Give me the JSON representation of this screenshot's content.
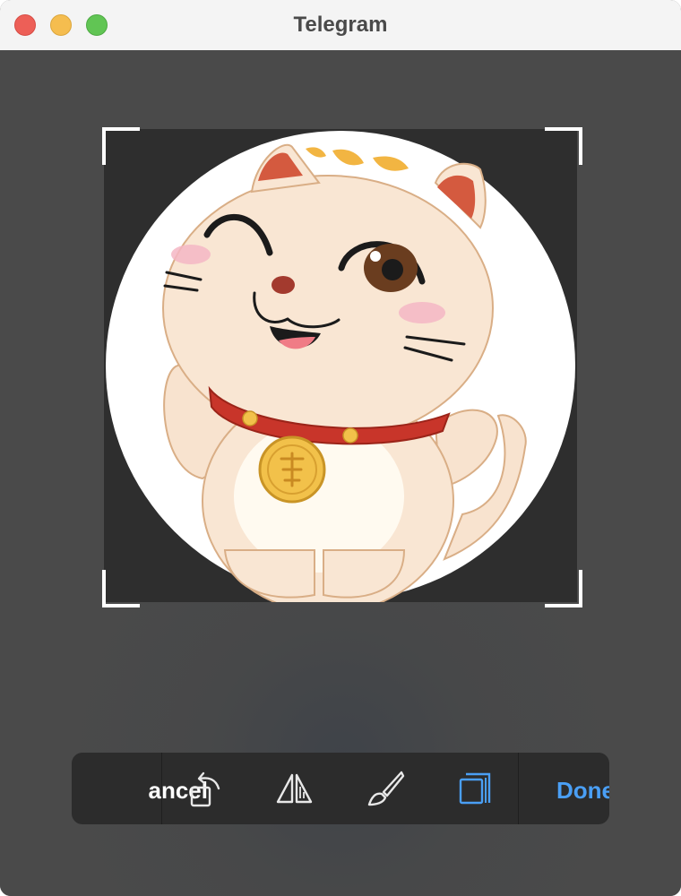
{
  "window": {
    "title": "Telegram"
  },
  "editor": {
    "image_subject": "lucky-cat-avatar",
    "crop_shape": "circle"
  },
  "toolbar": {
    "cancel_label": "ancel",
    "done_label": "Done",
    "tools": [
      {
        "name": "rotate",
        "icon": "rotate-icon",
        "active": false
      },
      {
        "name": "mirror",
        "icon": "flip-icon",
        "active": false
      },
      {
        "name": "paint",
        "icon": "brush-icon",
        "active": false
      },
      {
        "name": "aspect",
        "icon": "aspect-ratio-icon",
        "active": true
      }
    ]
  },
  "colors": {
    "accent": "#4a9ff5",
    "toolbar_bg": "#2c2c2c",
    "canvas_bg": "#4a4a4a"
  }
}
